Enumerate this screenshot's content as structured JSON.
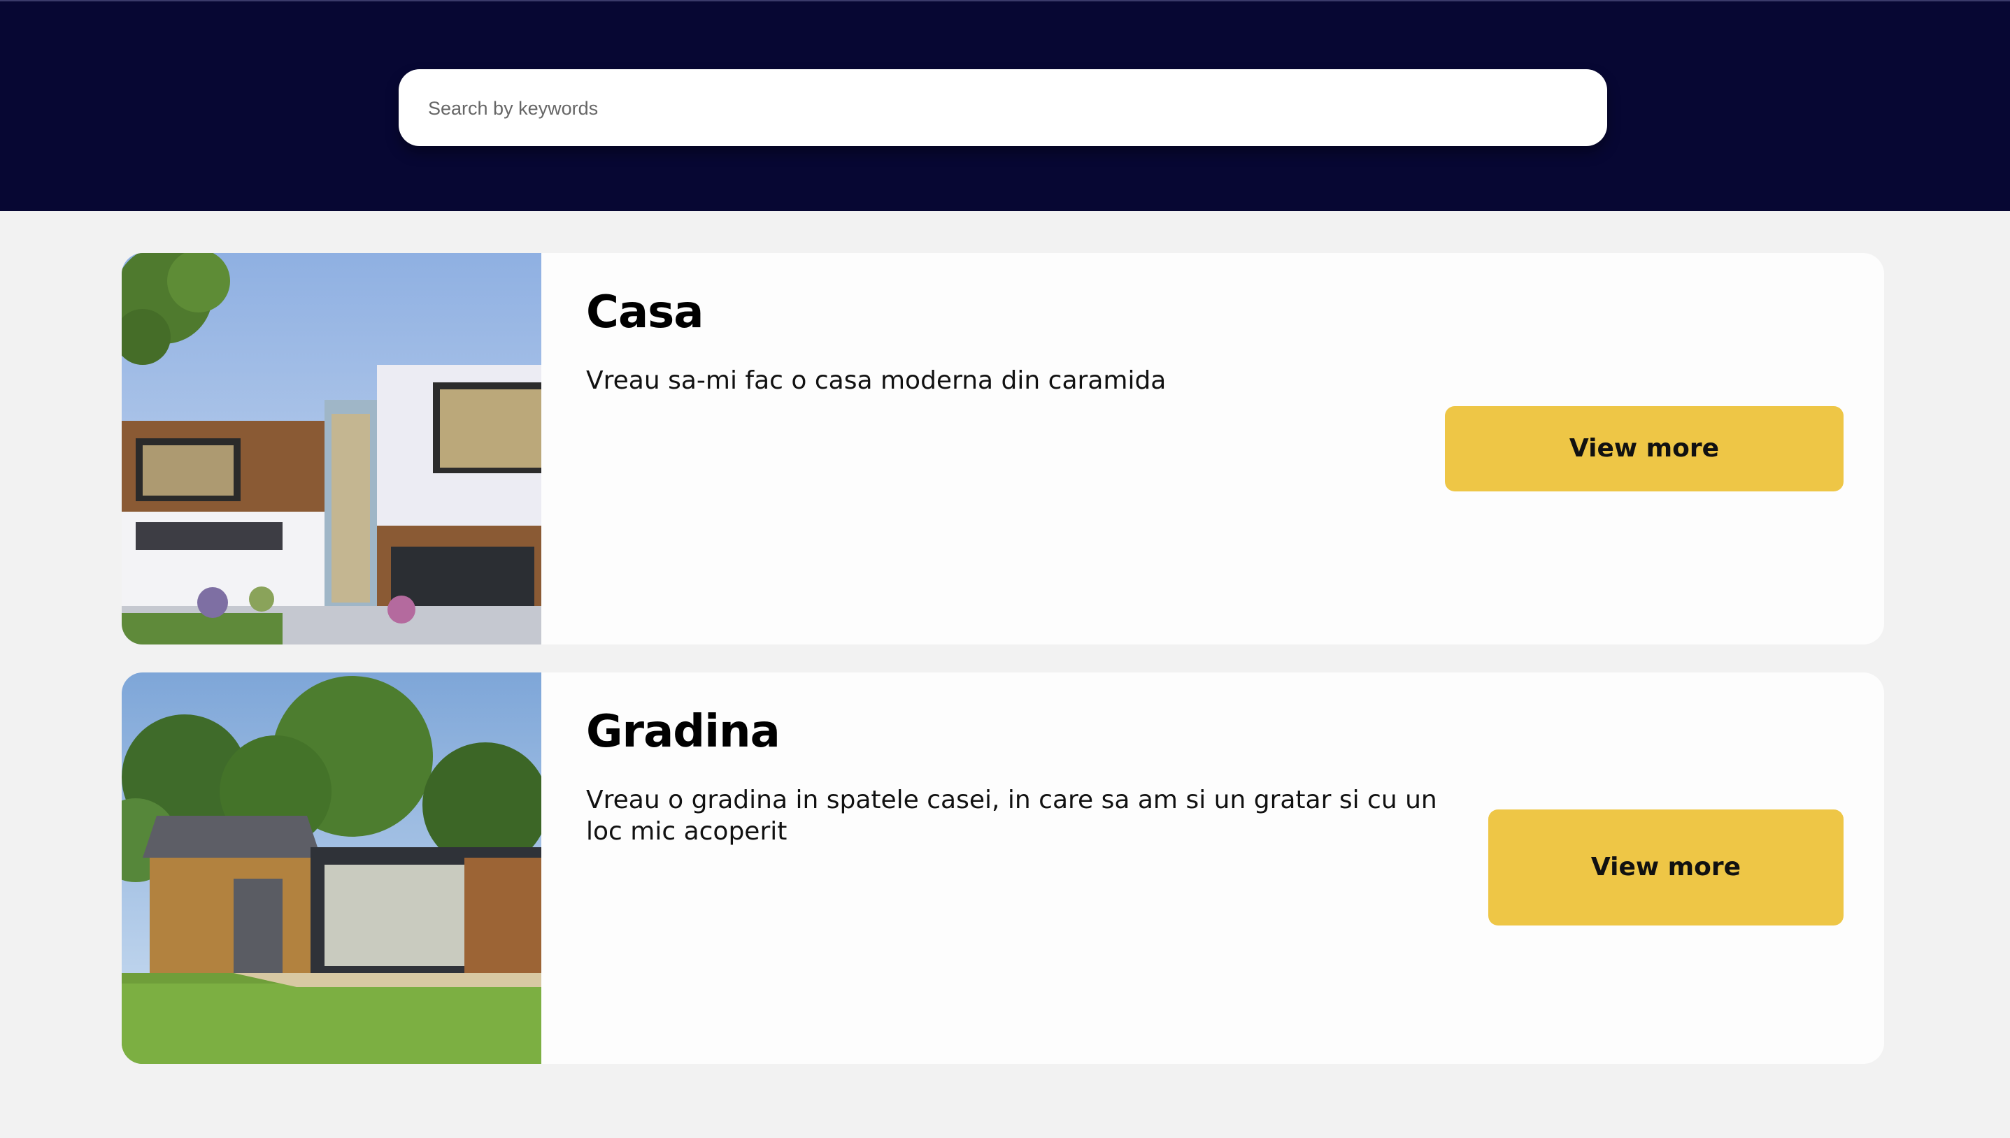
{
  "search": {
    "placeholder": "Search by keywords"
  },
  "colors": {
    "header_bg": "#070733",
    "page_bg": "#f2f2f2",
    "card_bg": "#fdfdfd",
    "button_bg": "#eec646"
  },
  "cards": [
    {
      "title": "Casa",
      "description": "Vreau sa-mi fac o casa moderna din caramida",
      "button_label": "View more",
      "image": "modern-house-photo"
    },
    {
      "title": "Gradina",
      "description": "Vreau o gradina in spatele casei, in care sa am si un gratar si cu un loc mic acoperit",
      "button_label": "View more",
      "image": "garden-studio-photo"
    }
  ]
}
